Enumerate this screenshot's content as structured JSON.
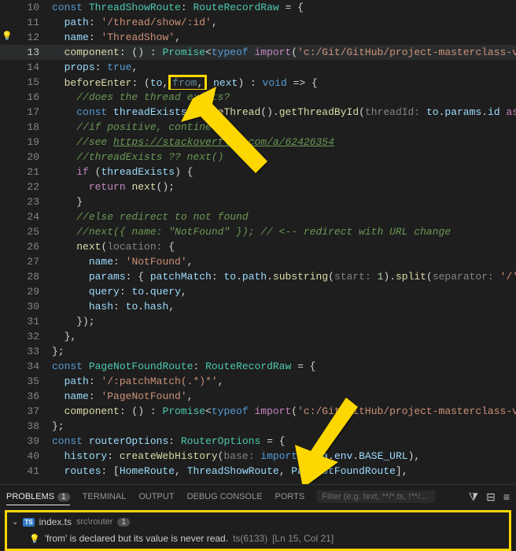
{
  "lines": {
    "10": {
      "num": "10"
    },
    "11": {
      "num": "11"
    },
    "12": {
      "num": "12"
    },
    "13": {
      "num": "13"
    },
    "14": {
      "num": "14"
    },
    "15": {
      "num": "15"
    },
    "16": {
      "num": "16"
    },
    "17": {
      "num": "17"
    },
    "18": {
      "num": "18"
    },
    "19": {
      "num": "19"
    },
    "20": {
      "num": "20"
    },
    "21": {
      "num": "21"
    },
    "22": {
      "num": "22"
    },
    "23": {
      "num": "23"
    },
    "24": {
      "num": "24"
    },
    "25": {
      "num": "25"
    },
    "26": {
      "num": "26"
    },
    "27": {
      "num": "27"
    },
    "28": {
      "num": "28"
    },
    "29": {
      "num": "29"
    },
    "30": {
      "num": "30"
    },
    "31": {
      "num": "31"
    },
    "32": {
      "num": "32"
    },
    "33": {
      "num": "33"
    },
    "34": {
      "num": "34"
    },
    "35": {
      "num": "35"
    },
    "36": {
      "num": "36"
    },
    "37": {
      "num": "37"
    },
    "38": {
      "num": "38"
    },
    "39": {
      "num": "39"
    },
    "40": {
      "num": "40"
    },
    "41": {
      "num": "41"
    }
  },
  "code": {
    "const": "const",
    "ThreadShowRoute": "ThreadShowRoute",
    "RouteRecordRaw": "RouteRecordRaw",
    "eq": " = {",
    "path": "path",
    "threadPath": "'/thread/show/:id'",
    "name": "name",
    "ThreadShow": "'ThreadShow'",
    "component": "component",
    "Promise": "Promise",
    "typeof": "typeof",
    "import": " import",
    "cpath": "'c:/Git/GitHub/project-masterclass-vi",
    "props": "props",
    "true": "true",
    "beforeEnter": "beforeEnter",
    "to": "to",
    "from": "from",
    "next": "next",
    "void": "void",
    "arrow": " => {",
    "c16": "//does the thread exists?",
    "threadExists": "threadExists",
    "useThread": "useThread",
    "getThreadById": "getThreadById",
    "threadId": "threadId",
    "params": "params",
    "id": "id",
    "as": " as ",
    "c18": "//if positive, contine",
    "c19a": "//see ",
    "c19b": "https://stackoverflow.com/a/62426354",
    "c20": "//threadExists ?? next()",
    "if": "if",
    "return": "return",
    "c24": "//else redirect to not found",
    "c25": "//next({ name: \"NotFound\" }); // <-- redirect with URL change",
    "location": "location",
    "NotFound": "'NotFound'",
    "patchMatch": "patchMatch",
    "substring": "substring",
    "start": "start",
    "one": "1",
    "split": "split",
    "separator": "separator",
    "slash": "'/'",
    "query": "query",
    "hash": "hash",
    "PageNotFoundRoute": "PageNotFoundRoute",
    "notFoundPath": "'/:patchMatch(.*)*'",
    "PageNotFound": "'PageNotFound'",
    "routerOptions": "routerOptions",
    "RouterOptions": "RouterOptions",
    "history": "history",
    "createWebHistory": "createWebHistory",
    "base": "base",
    "meta": "meta",
    "env": "env",
    "BASE_URL": "BASE_URL",
    "routes": "routes",
    "HomeRoute": "HomeRoute"
  },
  "panel": {
    "tabs": {
      "problems": "PROBLEMS",
      "problemsCount": "1",
      "terminal": "TERMINAL",
      "output": "OUTPUT",
      "debug": "DEBUG CONSOLE",
      "ports": "PORTS"
    },
    "filterPlaceholder": "Filter (e.g. text, **/*.ts, !**/...",
    "file": {
      "icon": "TS",
      "name": "index.ts",
      "path": "src\\router",
      "count": "1"
    },
    "problem": {
      "message": "'from' is declared but its value is never read.",
      "code": "ts(6133)",
      "location": "[Ln 15, Col 21]"
    }
  }
}
